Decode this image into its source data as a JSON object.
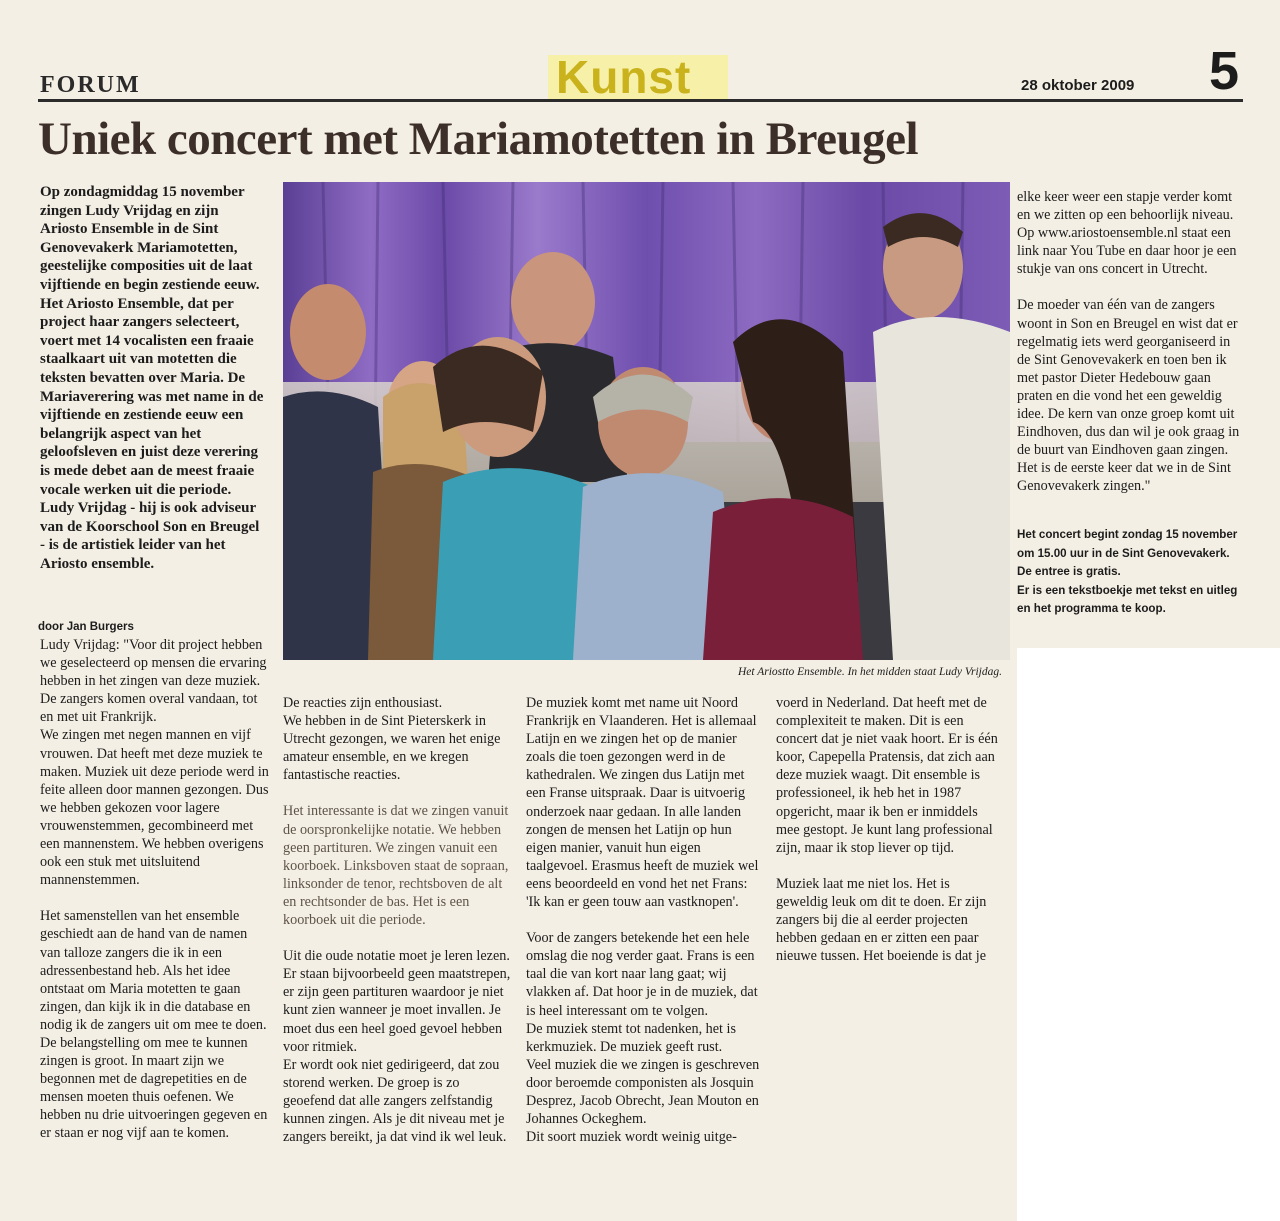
{
  "header": {
    "brand": "FORUM",
    "section": "Kunst",
    "date": "28 oktober 2009",
    "page_number": "5"
  },
  "article": {
    "headline": "Uniek concert met Mariamotetten in Breugel",
    "intro": "Op zondagmiddag 15 november zingen Ludy Vrijdag en zijn Ariosto Ensemble in de Sint Genovevakerk Mariamotetten, geestelijke composities uit de laat vijftiende en begin zestiende eeuw. Het Ariosto Ensemble, dat per project haar zangers selecteert, voert met 14 vocalisten een fraaie staalkaart uit van motetten die teksten bevatten over Maria. De Mariaverering was met name in de vijftiende en zestiende eeuw een belangrijk aspect van het geloofsleven en juist deze verering is mede debet aan de meest fraaie vocale werken uit die periode. Ludy Vrijdag - hij is ook adviseur van de Koorschool Son en Breugel - is de artistiek leider van het Ariosto ensemble.",
    "byline": "door Jan Burgers",
    "photo_caption": "Het Ariostto Ensemble. In het midden staat Ludy Vrijdag.",
    "col1": {
      "p1": "Ludy Vrijdag: \"Voor dit project hebben we geselecteerd op mensen die ervaring hebben in het zingen van deze muziek. De zangers komen overal vandaan, tot en met uit Frankrijk.",
      "p2": "We zingen met negen mannen en vijf vrouwen. Dat heeft met deze muziek te maken. Muziek uit deze periode werd in feite alleen door mannen gezongen. Dus we hebben gekozen voor lagere vrouwenstemmen, gecombineerd met een mannenstem. We hebben overigens ook een stuk met uitsluitend mannenstemmen.",
      "p3": "Het samenstellen van het ensemble geschiedt aan de hand van de namen van talloze zangers die ik in een adressenbestand heb. Als het idee ontstaat om Maria motetten te gaan zingen, dan kijk ik in die database en nodig ik de zangers uit om mee te doen.",
      "p4": "De belangstelling om mee te kunnen zingen is groot. In maart zijn we begonnen met de dagrepetities en de mensen moeten thuis oefenen. We hebben nu drie uitvoeringen gegeven en er staan er nog vijf aan te komen."
    },
    "col2": {
      "p1": "De reacties zijn enthousiast.",
      "p2": "We hebben in de Sint Pieterskerk in Utrecht gezongen, we waren het enige amateur ensemble, en we kregen fantastische reacties.",
      "p3": "Het interessante is dat we zingen vanuit de oorspronkelijke notatie. We hebben geen partituren. We zingen vanuit een koorboek. Linksboven staat de sopraan, linksonder de tenor, rechtsboven de alt en rechtsonder de bas. Het is een koorboek uit die periode.",
      "p4": "Uit die oude notatie moet je leren lezen. Er staan bijvoorbeeld geen maatstrepen, er zijn geen partituren waardoor je niet kunt zien wanneer je moet invallen. Je moet dus een heel goed gevoel hebben voor ritmiek.",
      "p5": "Er wordt ook niet gedirigeerd, dat zou storend werken. De groep is zo geoefend dat alle zangers zelfstandig kunnen zingen. Als je dit niveau met je zangers bereikt, ja dat vind ik wel leuk."
    },
    "col3": {
      "p1": "De muziek komt met name uit Noord Frankrijk en Vlaanderen. Het is allemaal Latijn en we zingen het op de manier zoals die toen gezongen werd in de kathedralen. We zingen dus Latijn met een Franse uitspraak. Daar is uitvoerig onderzoek naar gedaan. In alle landen zongen de mensen het Latijn op hun eigen manier, vanuit hun eigen taalgevoel. Erasmus heeft de muziek wel eens beoordeeld en vond het net Frans: 'Ik kan er geen touw aan vastknopen'.",
      "p2": "Voor de zangers betekende het een hele omslag die nog verder gaat. Frans is een taal die van kort naar lang gaat; wij vlakken af. Dat hoor je in de muziek, dat is heel interessant om te volgen.",
      "p3": "De muziek stemt tot nadenken, het is kerkmuziek. De muziek geeft rust.",
      "p4": "Veel muziek die we zingen is geschreven door beroemde componisten als Josquin Desprez, Jacob Obrecht, Jean Mouton en Johannes Ockeghem.",
      "p5": "Dit soort muziek wordt weinig uitge-"
    },
    "col4": {
      "p1": "voerd in Nederland. Dat heeft met de complexiteit te maken. Dit is een concert dat je niet vaak hoort. Er is één koor, Capepella Pratensis, dat zich aan deze muziek waagt. Dit ensemble is professioneel, ik heb het in 1987 opgericht, maar ik ben er inmiddels mee gestopt. Je kunt lang professional zijn, maar ik stop liever op tijd.",
      "p2": "Muziek laat me niet los. Het is geweldig leuk om dit te doen. Er zijn zangers bij die al eerder projecten hebben gedaan en er zitten een paar nieuwe tussen. Het boeiende is dat je"
    },
    "col5": {
      "p1": "elke keer weer een stapje verder komt en we zitten op een behoorlijk niveau. Op www.ariostoensemble.nl staat een link naar You Tube en daar hoor je een stukje van ons concert in Utrecht.",
      "p2": "De moeder van één van de zangers woont in Son en Breugel en wist dat er regelmatig iets werd georganiseerd in de Sint Genovevakerk en toen ben ik met pastor Dieter Hedebouw gaan praten en die vond het een geweldig idee. De kern van onze groep komt uit Eindhoven, dus dan wil je ook graag in de buurt van Eindhoven gaan zingen. Het is de eerste keer dat we in de Sint Genovevakerk zingen.\""
    },
    "info": {
      "line1": "Het concert begint zondag 15 november om 15.00 uur in de Sint Genovevakerk.",
      "line2": "De entree is gratis.",
      "line3": "Er is een tekstboekje met tekst en uitleg en het programma te koop."
    }
  },
  "colors": {
    "paper": "#f4efe4",
    "section_text": "#c9b21c",
    "section_highlight": "#f7f0a8",
    "headline": "#3c2f2a",
    "curtain": "#7d5cb5"
  }
}
